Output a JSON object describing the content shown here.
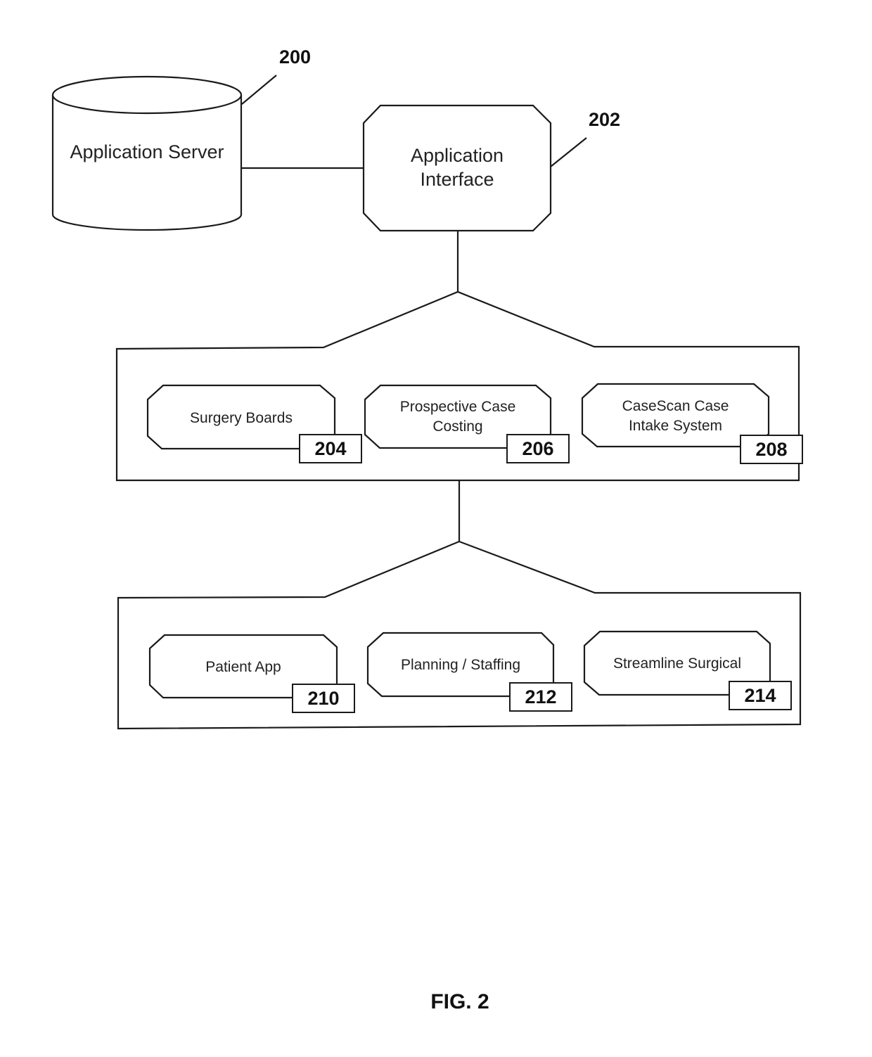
{
  "figure": {
    "caption": "FIG. 2",
    "server": {
      "label": "Application Server",
      "ref": "200",
      "icon": "database-cylinder-icon"
    },
    "interface": {
      "label_line1": "Application",
      "label_line2": "Interface",
      "ref": "202"
    },
    "group1": {
      "modules": [
        {
          "line1": "Surgery Boards",
          "line2": "",
          "ref": "204"
        },
        {
          "line1": "Prospective Case",
          "line2": "Costing",
          "ref": "206"
        },
        {
          "line1": "CaseScan Case",
          "line2": "Intake System",
          "ref": "208"
        }
      ]
    },
    "group2": {
      "modules": [
        {
          "line1": "Patient App",
          "line2": "",
          "ref": "210"
        },
        {
          "line1": "Planning / Staffing",
          "line2": "",
          "ref": "212"
        },
        {
          "line1": "Streamline Surgical",
          "line2": "",
          "ref": "214"
        }
      ]
    }
  }
}
